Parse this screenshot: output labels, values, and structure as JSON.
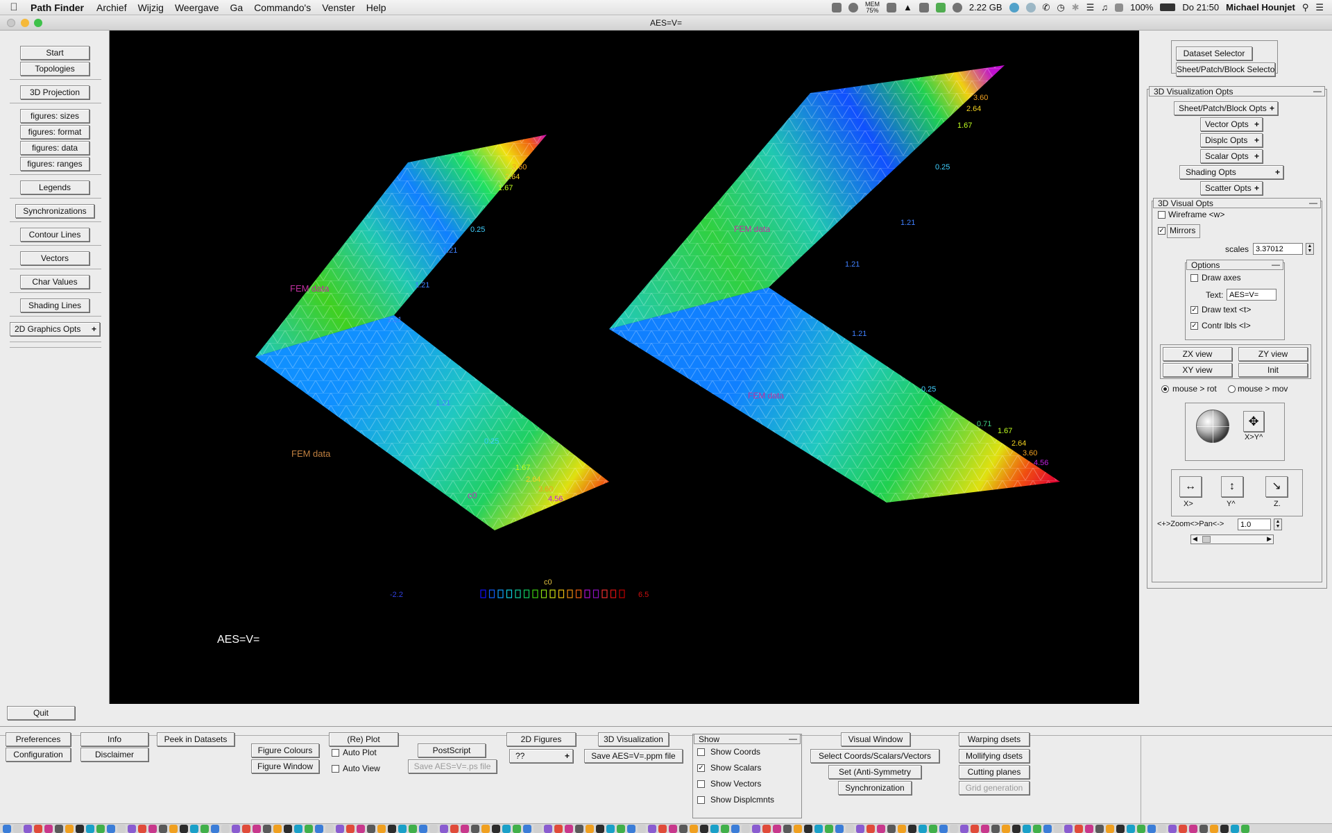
{
  "menubar": {
    "app_name": "Path Finder",
    "items": [
      "Archief",
      "Wijzig",
      "Weergave",
      "Ga",
      "Commando's",
      "Venster",
      "Help"
    ],
    "mem_label": "MEM",
    "mem_value": "75%",
    "memory": "2.22 GB",
    "battery": "100%",
    "clock": "Do 21:50",
    "user": "Michael Hounjet"
  },
  "window": {
    "title": "AES=V="
  },
  "left_panel": {
    "start": "Start",
    "topologies": "Topologies",
    "projection": "3D Projection",
    "fig_sizes": "figures: sizes",
    "fig_format": "figures: format",
    "fig_data": "figures: data",
    "fig_ranges": "figures: ranges",
    "legends": "Legends",
    "synchronizations": "Synchronizations",
    "contour_lines": "Contour Lines",
    "vectors": "Vectors",
    "char_values": "Char Values",
    "shading_lines": "Shading Lines",
    "graphics_opts": "2D Graphics Opts",
    "quit": "Quit"
  },
  "canvas": {
    "overlay_text": "AES=V=",
    "legend": {
      "title": "c0",
      "min": "-2.2",
      "max": "6.5",
      "swatches": [
        "#1010ff",
        "#1060ff",
        "#10a0ff",
        "#10d0e0",
        "#10d0a0",
        "#10d060",
        "#40d010",
        "#90e010",
        "#d0e010",
        "#f0c010",
        "#f09010",
        "#f06010",
        "#b010d0",
        "#9010c0",
        "#f03030",
        "#e01010",
        "#c00000"
      ]
    },
    "labels": {
      "c0": "c0",
      "fem": "FEM data",
      "v1": "1.21",
      "v2": "0.25",
      "v3": "1.67",
      "v4": "2.64",
      "v5": "3.60",
      "v6": "4.56",
      "v7": "0.71"
    }
  },
  "right_panel": {
    "dataset_selector": "Dataset Selector",
    "spb_selector": "Sheet/Patch/Block Selector",
    "viz_opts": "3D Visualization Opts",
    "spb_opts": "Sheet/Patch/Block Opts",
    "vector_opts": "Vector  Opts",
    "displ_opts": "Displc  Opts",
    "scalar_opts": "Scalar  Opts",
    "shading_opts": "Shading  Opts",
    "scatter_opts": "Scatter Opts",
    "visual_opts": "3D Visual Opts",
    "wireframe": "Wireframe <w>",
    "mirrors": "Mirrors",
    "scales_label": "scales",
    "scales_value": "3.37012",
    "options": "Options",
    "draw_axes": "Draw axes",
    "text_label": "Text:",
    "text_value": "AES=V=",
    "draw_text": "Draw  text <t>",
    "contr_lbls": "Contr lbls <l>",
    "zx_view": "ZX view",
    "zy_view": "ZY view",
    "xy_view": "XY view",
    "init": "Init",
    "mouse_rot": "mouse >  rot",
    "mouse_mov": "mouse >  mov",
    "trackball_caption": "X>Y^",
    "axis_x": "X>",
    "axis_y": "Y^",
    "axis_z": "Z.",
    "zoom_label": "<+>Zoom<>Pan<->",
    "zoom_value": "1.0"
  },
  "bottom_panel": {
    "preferences": "Preferences",
    "configuration": "Configuration",
    "info": "Info",
    "disclaimer": "Disclaimer",
    "peek": "Peek in Datasets",
    "figure_colours": "Figure Colours",
    "figure_window": "Figure Window",
    "replot": "(Re) Plot",
    "auto_plot": "Auto Plot",
    "auto_view": "Auto View",
    "postscript": "PostScript",
    "save_ps": "Save AES=V=.ps file",
    "figures_2d": "2D Figures",
    "figures_2d_value": "??",
    "viz_3d": "3D Visualization",
    "save_ppm": "Save AES=V=.ppm file",
    "show": "Show",
    "show_coords": "Show Coords",
    "show_scalars": "Show Scalars",
    "show_vectors": "Show Vectors",
    "show_displ": "Show Displcmnts",
    "visual_window": "Visual Window",
    "select_csv": "Select Coords/Scalars/Vectors",
    "set_antisym": "Set    (Anti-Symmetry",
    "synchronization": "Synchronization",
    "warping": "Warping    dsets",
    "mollifying": "Mollifying dsets",
    "cutting": "Cutting planes",
    "grid_gen": "Grid generation"
  }
}
